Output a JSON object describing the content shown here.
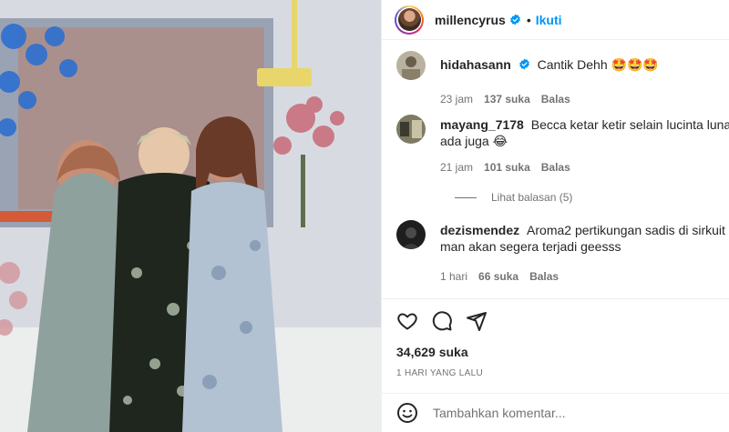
{
  "post": {
    "username": "millencyrus",
    "follow_label": "Ikuti",
    "separator": "•"
  },
  "comments": [
    {
      "user": "hidahasann",
      "verified": true,
      "text": "Cantik Dehh 🤩🤩🤩",
      "time": "23 jam",
      "likes": "137 suka",
      "reply": "Balas"
    },
    {
      "user": "mayang_7178",
      "verified": false,
      "text": "Becca ketar ketir selain lucinta luna ada juga 😂",
      "time": "21 jam",
      "likes": "101 suka",
      "reply": "Balas",
      "view_replies": "Lihat balasan (5)"
    },
    {
      "user": "dezismendez",
      "verified": false,
      "text": "Aroma2 pertikungan sadis di sirkuit man akan segera terjadi geesss",
      "time": "1 hari",
      "likes": "66 suka",
      "reply": "Balas"
    }
  ],
  "stats": {
    "likes": "34,629 suka",
    "date": "1 HARI YANG LALU"
  },
  "composer": {
    "placeholder": "Tambahkan komentar..."
  },
  "colors": {
    "accent": "#0095f6",
    "text": "#262626",
    "secondary": "#737373",
    "border": "#efefef"
  },
  "icons": {
    "like": "heart-icon",
    "comment": "comment-icon",
    "share": "share-icon",
    "emoji": "smiley-icon"
  }
}
